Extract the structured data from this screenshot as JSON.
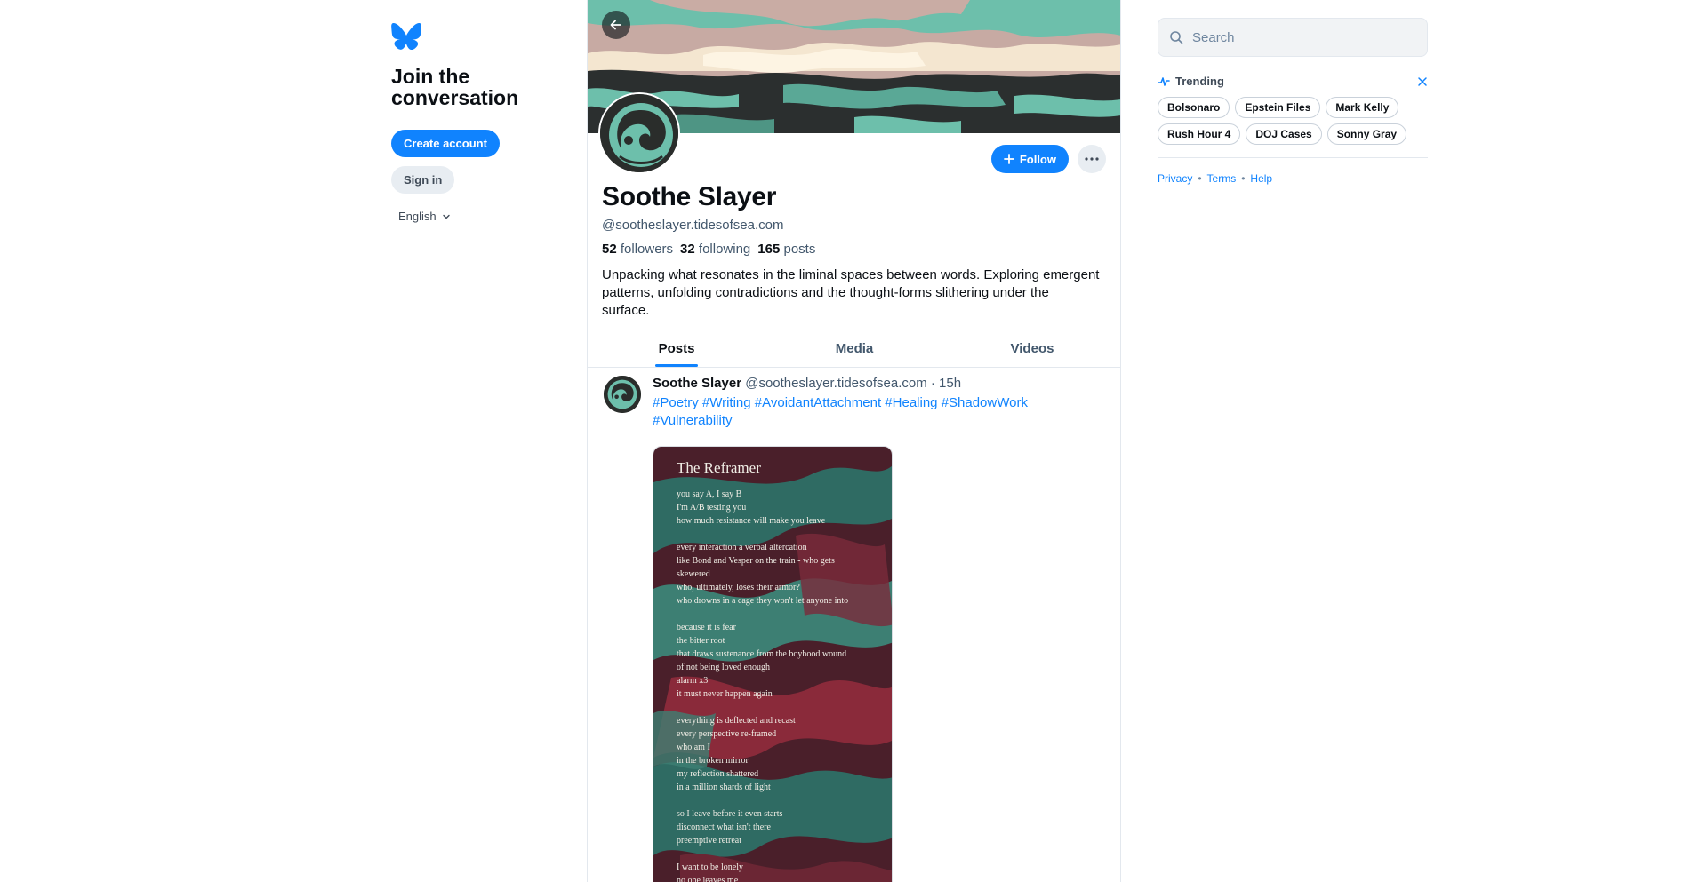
{
  "colors": {
    "accent": "#1083fe",
    "text": "#0b0f14",
    "muted": "#42576c",
    "border": "#e3e8ee"
  },
  "sidebar": {
    "logo_icon": "butterfly-icon",
    "heading": "Join the conversation",
    "create_account": "Create account",
    "sign_in": "Sign in",
    "language": "English"
  },
  "profile": {
    "display_name": "Soothe Slayer",
    "handle": "@sootheslayer.tidesofsea.com",
    "followers_count": "52",
    "followers_label": "followers",
    "following_count": "32",
    "following_label": "following",
    "posts_count": "165",
    "posts_label": "posts",
    "bio": "Unpacking what resonates in the liminal spaces between words. Exploring emergent patterns, unfolding contradictions and the thought-forms slithering under the surface.",
    "follow_label": "Follow"
  },
  "tabs": [
    {
      "label": "Posts",
      "active": true
    },
    {
      "label": "Media",
      "active": false
    },
    {
      "label": "Videos",
      "active": false
    }
  ],
  "post": {
    "author": "Soothe Slayer",
    "handle": "@sootheslayer.tidesofsea.com",
    "time": "· 15h",
    "tags": [
      "#Poetry",
      "#Writing",
      "#AvoidantAttachment",
      "#Healing",
      "#ShadowWork",
      "#Vulnerability"
    ],
    "image": {
      "title": "The Reframer",
      "stanzas": [
        [
          "you say A, I say B",
          "I'm A/B testing you",
          "how much resistance will make you leave"
        ],
        [
          "every interaction a verbal altercation",
          "like Bond and Vesper on the train - who gets",
          "skewered",
          "who, ultimately, loses their armor?",
          "who drowns in a cage they won't let anyone into"
        ],
        [
          "because it is fear",
          "the bitter root",
          "that draws sustenance from the boyhood wound",
          "of not being loved enough",
          "alarm x3",
          "it must never happen again"
        ],
        [
          "everything is deflected and recast",
          "every perspective re-framed",
          "who am I",
          "in the broken mirror",
          "my reflection shattered",
          "in a million shards of light"
        ],
        [
          "so I leave before it even starts",
          "disconnect what isn't there",
          "preemptive retreat"
        ],
        [
          "I want to be lonely",
          "no one leaves me"
        ]
      ]
    }
  },
  "right": {
    "search_placeholder": "Search",
    "trending_label": "Trending",
    "trending": [
      "Bolsonaro",
      "Epstein Files",
      "Mark Kelly",
      "Rush Hour 4",
      "DOJ Cases",
      "Sonny Gray"
    ],
    "footer": [
      "Privacy",
      "Terms",
      "Help"
    ]
  }
}
